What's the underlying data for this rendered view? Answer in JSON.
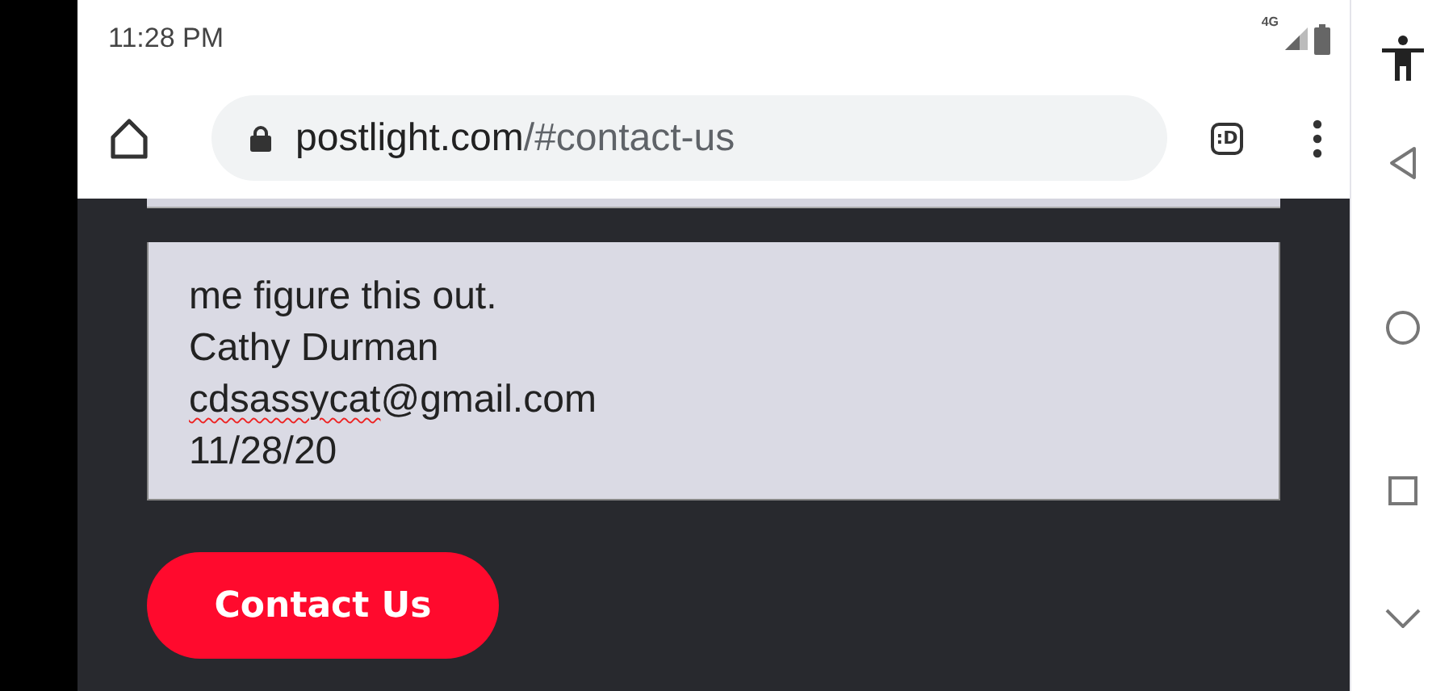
{
  "status_bar": {
    "time": "11:28 PM",
    "network": "4G"
  },
  "address_bar": {
    "host": "postlight.com",
    "path": "/#contact-us",
    "tab_button": ":D"
  },
  "message": {
    "lines": [
      {
        "parts": [
          {
            "text": "me figure this out.",
            "misspelled": false
          }
        ]
      },
      {
        "parts": [
          {
            "text": "Cathy Durman",
            "misspelled": false
          }
        ]
      },
      {
        "parts": [
          {
            "text": "cdsassycat",
            "misspelled": true
          },
          {
            "text": "@gmail.com",
            "misspelled": false
          }
        ]
      },
      {
        "parts": [
          {
            "text": "11/28/20",
            "misspelled": false
          }
        ]
      }
    ]
  },
  "submit_button": {
    "label": "Contact Us"
  }
}
